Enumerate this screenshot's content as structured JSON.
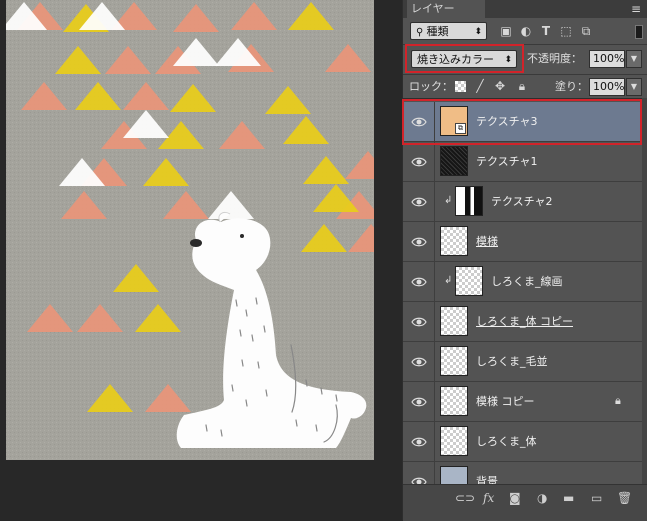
{
  "panel": {
    "tab_label": "レイヤー",
    "filter_label": "種類",
    "blend_mode": "焼き込みカラー",
    "opacity_label": "不透明度：",
    "opacity_value": "100%",
    "lock_label": "ロック：",
    "fill_label": "塗り：",
    "fill_value": "100%"
  },
  "layers": [
    {
      "name": "テクスチャ3",
      "selected": true,
      "thumb": "tan",
      "clipped": false,
      "underline": false
    },
    {
      "name": "テクスチャ1",
      "selected": false,
      "thumb": "dark",
      "clipped": false,
      "underline": false
    },
    {
      "name": "テクスチャ2",
      "selected": false,
      "thumb": "bw",
      "clipped": true,
      "underline": false
    },
    {
      "name": "模様",
      "selected": false,
      "thumb": "checker",
      "clipped": false,
      "underline": true
    },
    {
      "name": "しろくま_線画",
      "selected": false,
      "thumb": "checker",
      "clipped": true,
      "underline": false
    },
    {
      "name": "しろくま_体 コピー",
      "selected": false,
      "thumb": "checker",
      "clipped": false,
      "underline": true
    },
    {
      "name": "しろくま_毛並",
      "selected": false,
      "thumb": "checker",
      "clipped": false,
      "underline": false
    },
    {
      "name": "模様 コピー",
      "selected": false,
      "thumb": "checker",
      "clipped": false,
      "underline": false,
      "locked": true
    },
    {
      "name": "しろくま_体",
      "selected": false,
      "thumb": "checker",
      "clipped": false,
      "underline": false
    },
    {
      "name": "背景",
      "selected": false,
      "thumb": "blue",
      "clipped": false,
      "underline": false
    }
  ],
  "colors": {
    "accent_highlight": "#d2232a",
    "selected_layer": "#6d7a90",
    "canvas_bg": "#a4a39c",
    "salmon": "#e8957a",
    "yellow": "#e8cc1a"
  },
  "icons": [
    "search-icon",
    "image-filter-icon",
    "adjust-filter-icon",
    "text-filter-icon",
    "shape-filter-icon",
    "smart-filter-icon",
    "toggle-icon",
    "lock-pixels-icon",
    "lock-brush-icon",
    "lock-move-icon",
    "lock-all-icon",
    "eye-icon",
    "link-icon",
    "fx-icon",
    "mask-icon",
    "adjustment-icon",
    "folder-icon",
    "new-layer-icon",
    "trash-icon"
  ]
}
